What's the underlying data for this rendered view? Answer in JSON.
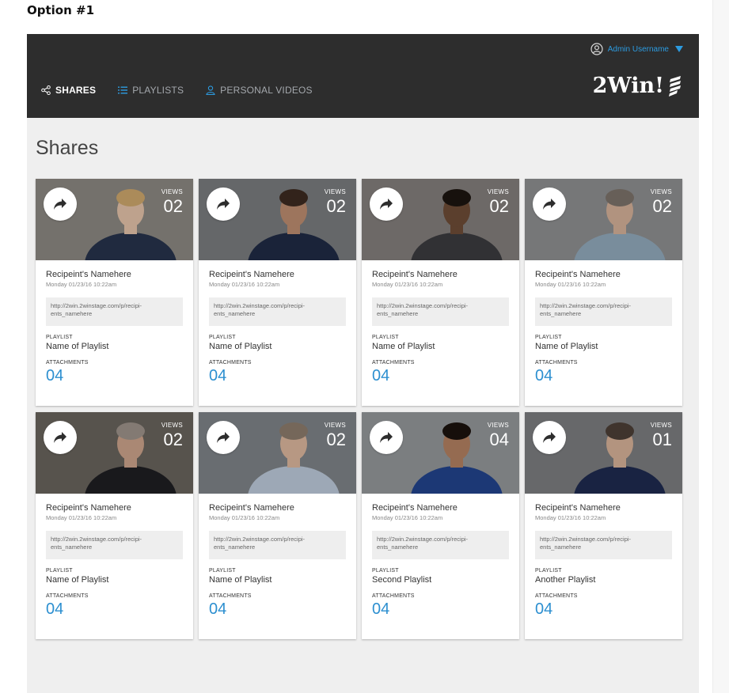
{
  "caption": "Option #1",
  "header": {
    "user": "Admin Username",
    "brand": "2Win!",
    "nav": [
      {
        "label": "SHARES",
        "icon": "share-icon"
      },
      {
        "label": "PLAYLISTS",
        "icon": "list-icon"
      },
      {
        "label": "PERSONAL VIDEOS",
        "icon": "person-icon"
      }
    ]
  },
  "page_title": "Shares",
  "labels": {
    "views": "VIEWS",
    "playlist": "PLAYLIST",
    "attachments": "ATTACHMENTS"
  },
  "colors": {
    "accent": "#2c9be0",
    "attachments": "#2c8fd0",
    "topbar": "#2d2d2d",
    "page_bg": "#efefef"
  },
  "cards": [
    {
      "views": "02",
      "recipient": "Recipeint's Namehere",
      "date": "Monday 01/23/16 10:22am",
      "link": "http://2win.2winstage.com/p/recipi-ents_namehere",
      "playlist": "Name of Playlist",
      "attachments": "04"
    },
    {
      "views": "02",
      "recipient": "Recipeint's Namehere",
      "date": "Monday 01/23/16 10:22am",
      "link": "http://2win.2winstage.com/p/recipi-ents_namehere",
      "playlist": "Name of Playlist",
      "attachments": "04"
    },
    {
      "views": "02",
      "recipient": "Recipeint's Namehere",
      "date": "Monday 01/23/16 10:22am",
      "link": "http://2win.2winstage.com/p/recipi-ents_namehere",
      "playlist": "Name of Playlist",
      "attachments": "04"
    },
    {
      "views": "02",
      "recipient": "Recipeint's Namehere",
      "date": "Monday 01/23/16 10:22am",
      "link": "http://2win.2winstage.com/p/recipi-ents_namehere",
      "playlist": "Name of Playlist",
      "attachments": "04"
    },
    {
      "views": "02",
      "recipient": "Recipeint's Namehere",
      "date": "Monday 01/23/16 10:22am",
      "link": "http://2win.2winstage.com/p/recipi-ents_namehere",
      "playlist": "Name of Playlist",
      "attachments": "04"
    },
    {
      "views": "02",
      "recipient": "Recipeint's Namehere",
      "date": "Monday 01/23/16 10:22am",
      "link": "http://2win.2winstage.com/p/recipi-ents_namehere",
      "playlist": "Name of Playlist",
      "attachments": "04"
    },
    {
      "views": "04",
      "recipient": "Recipeint's Namehere",
      "date": "Monday 01/23/16 10:22am",
      "link": "http://2win.2winstage.com/p/recipi-ents_namehere",
      "playlist": "Second Playlist",
      "attachments": "04"
    },
    {
      "views": "01",
      "recipient": "Recipeint's Namehere",
      "date": "Monday 01/23/16 10:22am",
      "link": "http://2win.2winstage.com/p/recipi-ents_namehere",
      "playlist": "Another Playlist",
      "attachments": "04"
    }
  ]
}
